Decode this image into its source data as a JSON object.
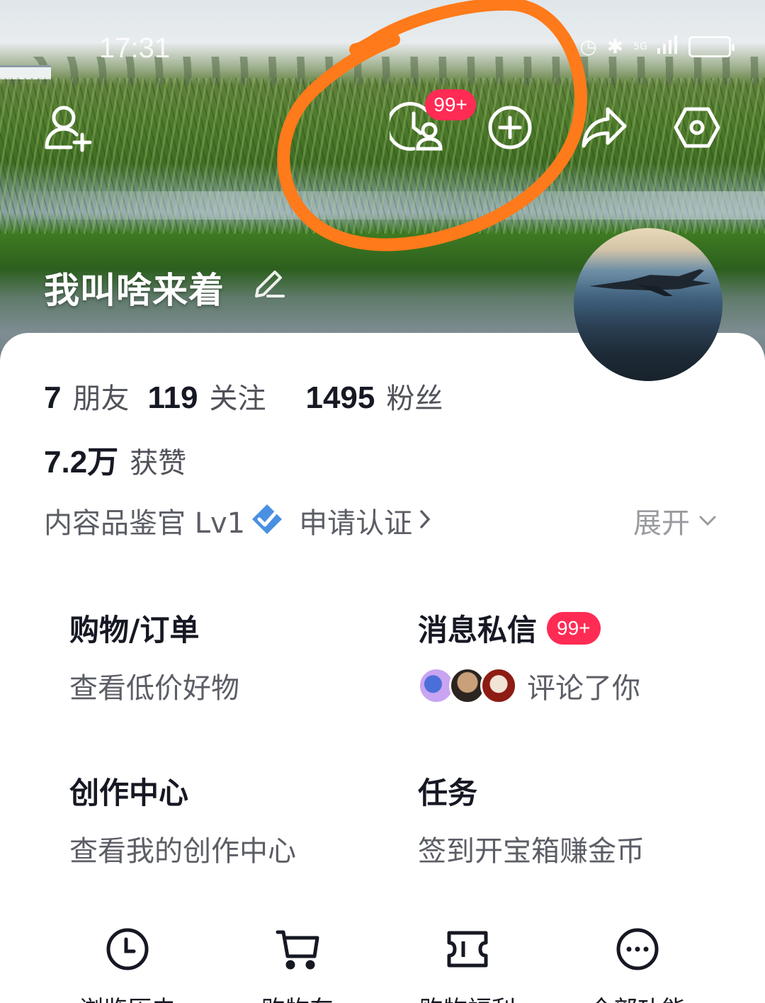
{
  "status_bar": {
    "time": "17:31",
    "network": "5G"
  },
  "header": {
    "badge": "99+"
  },
  "profile": {
    "username": "我叫啥来着"
  },
  "stats": {
    "friends_count": "7",
    "friends_label": "朋友",
    "following_count": "119",
    "following_label": "关注",
    "followers_count": "1495",
    "followers_label": "粉丝",
    "likes_count": "7.2万",
    "likes_label": "获赞"
  },
  "badge_row": {
    "level": "内容品鉴官 Lv1",
    "apply": "申请认证",
    "expand": "展开"
  },
  "features": {
    "shopping": {
      "title": "购物/订单",
      "subtitle": "查看低价好物"
    },
    "messages": {
      "title": "消息私信",
      "badge": "99+",
      "subtitle": "评论了你"
    },
    "creator": {
      "title": "创作中心",
      "subtitle": "查看我的创作中心"
    },
    "tasks": {
      "title": "任务",
      "subtitle": "签到开宝箱赚金币"
    }
  },
  "shortcuts": [
    {
      "label": "浏览历史",
      "icon": "clock-icon"
    },
    {
      "label": "购物车",
      "icon": "cart-icon"
    },
    {
      "label": "购物福利",
      "icon": "ticket-icon"
    },
    {
      "label": "全部功能",
      "icon": "more-icon"
    }
  ],
  "colors": {
    "accent_red": "#fe2c55",
    "annotation_orange": "#ff7a1a",
    "verify_blue": "#4a90e2"
  }
}
